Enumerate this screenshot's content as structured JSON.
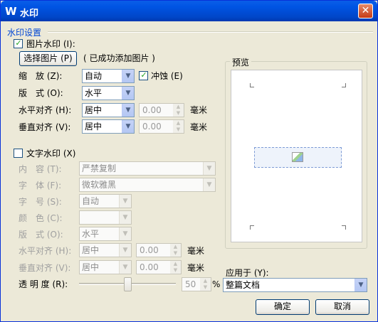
{
  "window": {
    "title": "水印",
    "title_icon": "W",
    "close_glyph": "✕"
  },
  "section": {
    "title": "水印设置"
  },
  "picture": {
    "checkbox_label": "图片水印 (I):",
    "checked": true,
    "choose_button": "选择图片 (P)",
    "status_text": "( 已成功添加图片 )",
    "scale_label": "缩　放 (Z):",
    "scale_value": "自动",
    "washout_label": "冲蚀 (E)",
    "washout_checked": true,
    "layout_label": "版　式 (O):",
    "layout_value": "水平",
    "halign_label": "水平对齐 (H):",
    "halign_value": "居中",
    "halign_offset": "0.00",
    "valign_label": "垂直对齐 (V):",
    "valign_value": "居中",
    "valign_offset": "0.00",
    "unit": "毫米"
  },
  "text": {
    "checkbox_label": "文字水印 (X)",
    "checked": false,
    "content_label": "内　容 (T):",
    "content_value": "严禁复制",
    "font_label": "字　体 (F):",
    "font_value": "微软雅黑",
    "size_label": "字　号 (S):",
    "size_value": "自动",
    "color_label": "颜　色 (C):",
    "color_value": "",
    "layout_label": "版　式 (O):",
    "layout_value": "水平",
    "halign_label": "水平对齐 (H):",
    "halign_value": "居中",
    "halign_offset": "0.00",
    "valign_label": "垂直对齐 (V):",
    "valign_value": "居中",
    "valign_offset": "0.00",
    "unit": "毫米",
    "opacity_label": "透 明 度 (R):",
    "opacity_value": "50",
    "opacity_unit": "%"
  },
  "preview": {
    "title": "预览"
  },
  "apply": {
    "label": "应用于 (Y):",
    "value": "整篇文档"
  },
  "buttons": {
    "ok": "确定",
    "cancel": "取消"
  },
  "colors": {
    "title_bar": "#0054e3",
    "dialog_bg": "#ece9d8",
    "section_title": "#0046d5"
  }
}
